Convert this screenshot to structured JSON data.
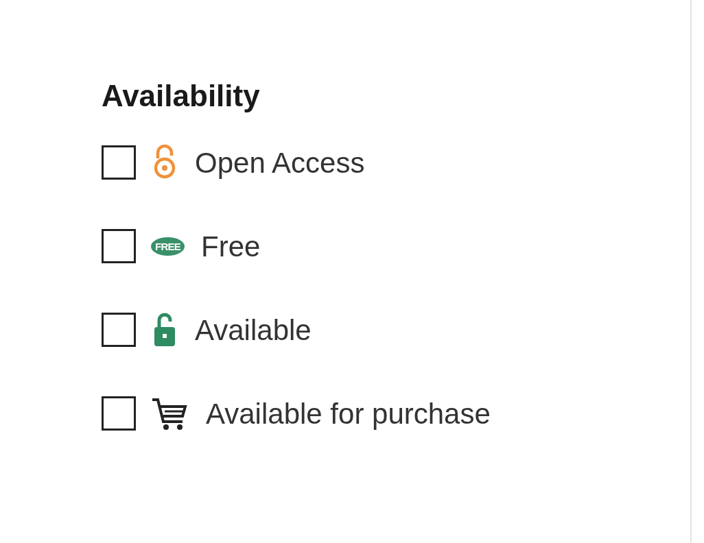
{
  "heading": "Availability",
  "options": [
    {
      "kind": "open-access",
      "label": "Open Access",
      "checked": false
    },
    {
      "kind": "free",
      "badge": "FREE",
      "label": "Free",
      "checked": false
    },
    {
      "kind": "available",
      "label": "Available",
      "checked": false
    },
    {
      "kind": "purchase",
      "label": "Available for purchase",
      "checked": false
    }
  ]
}
